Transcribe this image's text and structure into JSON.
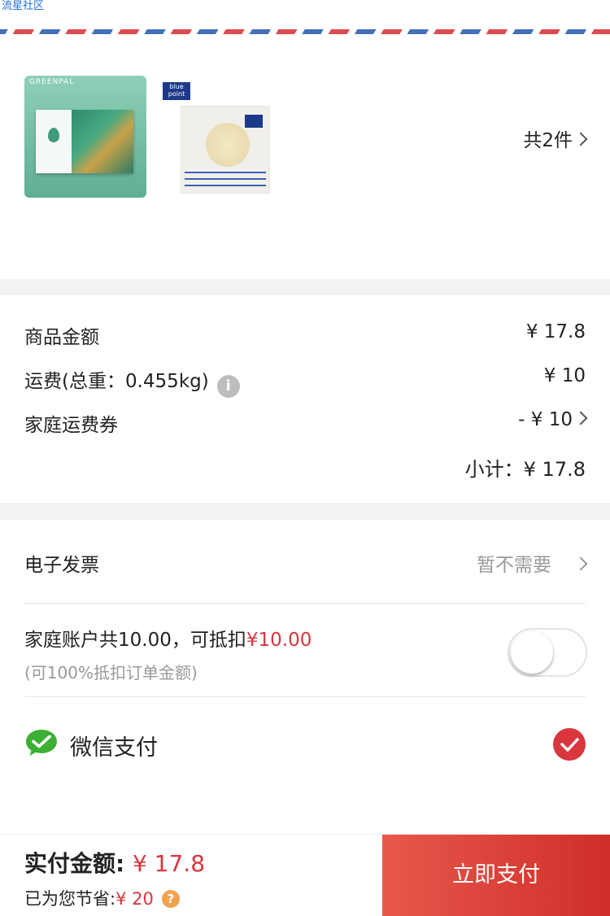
{
  "watermark": "流星社区",
  "products": {
    "item1_brand": "GREENPAL",
    "item2_brand_line1": "blue",
    "item2_brand_line2": "point",
    "count_label": "共2件"
  },
  "amounts": {
    "goods_label": "商品金额",
    "goods_value": "¥ 17.8",
    "shipping_label": "运费(总重：0.455kg)",
    "shipping_value": "¥ 10",
    "coupon_label": "家庭运费券",
    "coupon_value": "- ¥ 10",
    "subtotal_label": "小计：",
    "subtotal_value": "¥ 17.8",
    "info_glyph": "i"
  },
  "invoice": {
    "label": "电子发票",
    "value": "暂不需要"
  },
  "family_account": {
    "text_prefix": "家庭账户共10.00，可抵扣",
    "deductible": "¥10.00",
    "note": "(可100%抵扣订单金额)",
    "toggle_on": false
  },
  "wechat_pay": {
    "label": "微信支付",
    "selected": true
  },
  "footer": {
    "paid_label": "实付金额:",
    "paid_value": "¥ 17.8",
    "saved_label": "已为您节省:",
    "saved_value": "¥ 20",
    "help_glyph": "?",
    "pay_button": "立即支付"
  },
  "colors": {
    "accent_red": "#d9363e",
    "wechat_green": "#3cb034",
    "help_orange": "#f0a24d"
  }
}
